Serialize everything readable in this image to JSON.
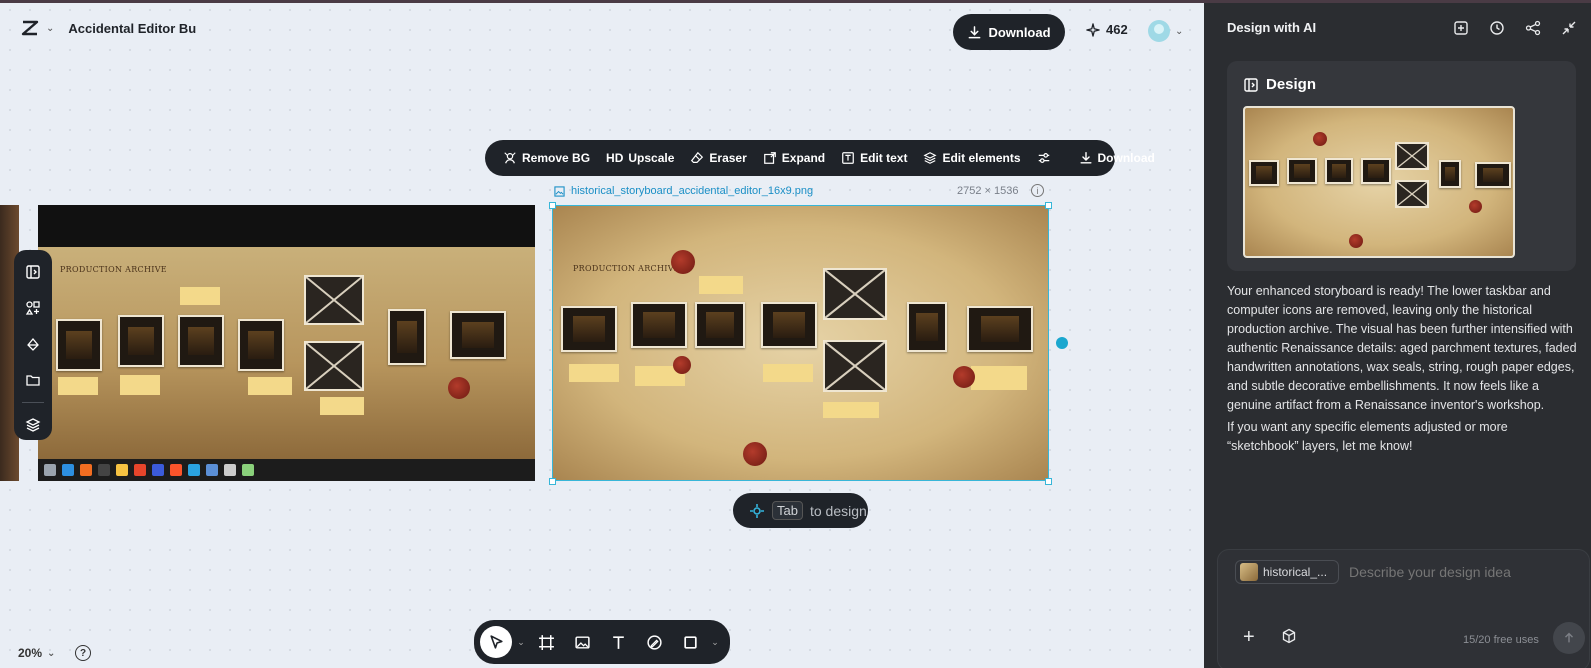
{
  "app": {
    "project_title": "Accidental Editor Bu",
    "logo_icon": "capcut-logo-icon"
  },
  "header": {
    "download_label": "Download",
    "credits": "462"
  },
  "image_toolbar": {
    "items": [
      {
        "label": "Remove BG",
        "icon": "remove-bg-icon"
      },
      {
        "label": "Upscale",
        "icon": "hd-icon",
        "prefix": "HD"
      },
      {
        "label": "Eraser",
        "icon": "eraser-icon"
      },
      {
        "label": "Expand",
        "icon": "expand-icon"
      },
      {
        "label": "Edit text",
        "icon": "edit-text-icon"
      },
      {
        "label": "Edit elements",
        "icon": "layers-icon"
      },
      {
        "label": "Download",
        "icon": "download-icon"
      }
    ]
  },
  "selected_image": {
    "filename": "historical_storyboard_accidental_editor_16x9.png",
    "dimensions": "2752 × 1536"
  },
  "storyboard_art": {
    "title": "PRODUCTION ARCHIVE"
  },
  "tab_hint": {
    "key": "Tab",
    "text": "to design"
  },
  "zoom": "20%",
  "right_panel": {
    "title": "Design with AI",
    "design_card_title": "Design",
    "message_1": "Your enhanced storyboard is ready! The lower taskbar and computer icons are removed, leaving only the historical production archive. The visual has been further intensified with authentic Renaissance details: aged parchment textures, faded handwritten annotations, wax seals, string, rough paper edges, and subtle decorative embellishments. It now feels like a genuine artifact from a Renaissance inventor's workshop.",
    "message_2": "If you want any specific elements adjusted or more “sketchbook” layers, let me know!",
    "composer": {
      "chip_label": "historical_...",
      "placeholder": "Describe your design idea",
      "free_uses": "15/20 free uses"
    }
  },
  "colors": {
    "accent": "#37b6d8",
    "dark": "#1f2329",
    "panel": "#2b2d31"
  }
}
